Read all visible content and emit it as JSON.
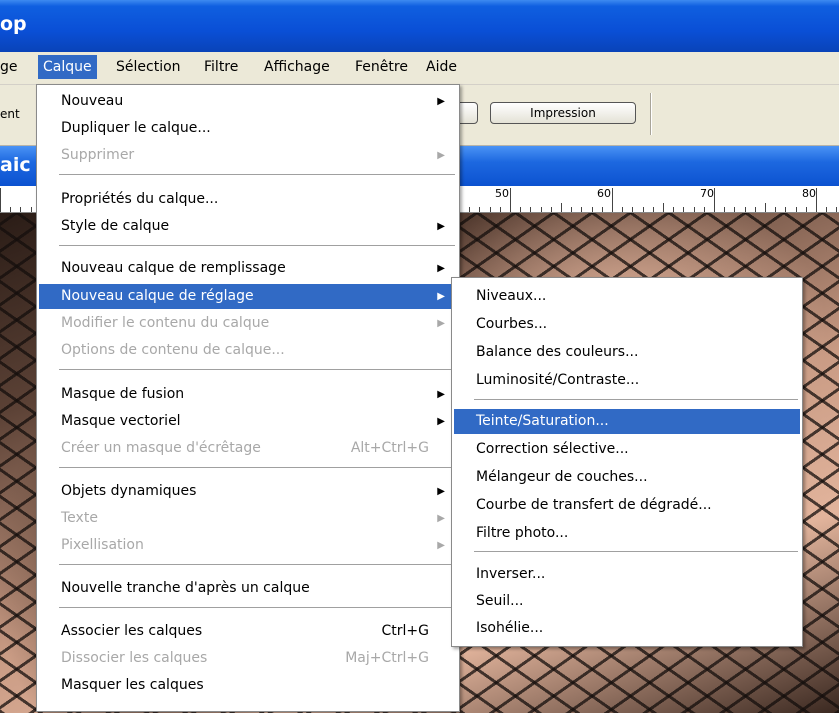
{
  "app": {
    "title": "op"
  },
  "menubar": {
    "items": [
      "ge",
      "Calque",
      "Sélection",
      "Filtre",
      "Affichage",
      "Fenêtre",
      "Aide"
    ]
  },
  "toolbar": {
    "left_label": "ent",
    "button_print": "Impression"
  },
  "document": {
    "title": "aic"
  },
  "ruler": {
    "labels": [
      "50",
      "60",
      "70",
      "80"
    ]
  },
  "calque_menu": {
    "items": [
      {
        "label": "Nouveau",
        "submenu": true
      },
      {
        "label": "Dupliquer le calque..."
      },
      {
        "label": "Supprimer",
        "disabled": true,
        "submenu": true
      },
      {
        "label": "Propriétés du calque..."
      },
      {
        "label": "Style de calque",
        "submenu": true
      },
      {
        "label": "Nouveau calque de remplissage",
        "submenu": true
      },
      {
        "label": "Nouveau calque de réglage",
        "submenu": true,
        "highlighted": true
      },
      {
        "label": "Modifier le contenu du calque",
        "disabled": true,
        "submenu": true
      },
      {
        "label": "Options de contenu de calque...",
        "disabled": true
      },
      {
        "label": "Masque de fusion",
        "submenu": true
      },
      {
        "label": "Masque vectoriel",
        "submenu": true
      },
      {
        "label": "Créer un masque d'écrêtage",
        "shortcut": "Alt+Ctrl+G",
        "disabled": true
      },
      {
        "label": "Objets dynamiques",
        "submenu": true
      },
      {
        "label": "Texte",
        "disabled": true,
        "submenu": true
      },
      {
        "label": "Pixellisation",
        "disabled": true,
        "submenu": true
      },
      {
        "label": "Nouvelle tranche d'après un calque"
      },
      {
        "label": "Associer les calques",
        "shortcut": "Ctrl+G"
      },
      {
        "label": "Dissocier les calques",
        "shortcut": "Maj+Ctrl+G",
        "disabled": true
      },
      {
        "label": "Masquer les calques"
      }
    ]
  },
  "reglage_submenu": {
    "items": [
      {
        "label": "Niveaux..."
      },
      {
        "label": "Courbes..."
      },
      {
        "label": "Balance des couleurs..."
      },
      {
        "label": "Luminosité/Contraste..."
      },
      {
        "label": "Teinte/Saturation...",
        "highlighted": true
      },
      {
        "label": "Correction sélective..."
      },
      {
        "label": "Mélangeur de couches..."
      },
      {
        "label": "Courbe de transfert de dégradé..."
      },
      {
        "label": "Filtre photo..."
      },
      {
        "label": "Inverser..."
      },
      {
        "label": "Seuil..."
      },
      {
        "label": "Isohélie..."
      }
    ]
  },
  "colors": {
    "highlight": "#316ac5",
    "menubar": "#ece9d8",
    "titlebar": "#0a4fd6",
    "disabled_text": "#a8a8a8"
  }
}
